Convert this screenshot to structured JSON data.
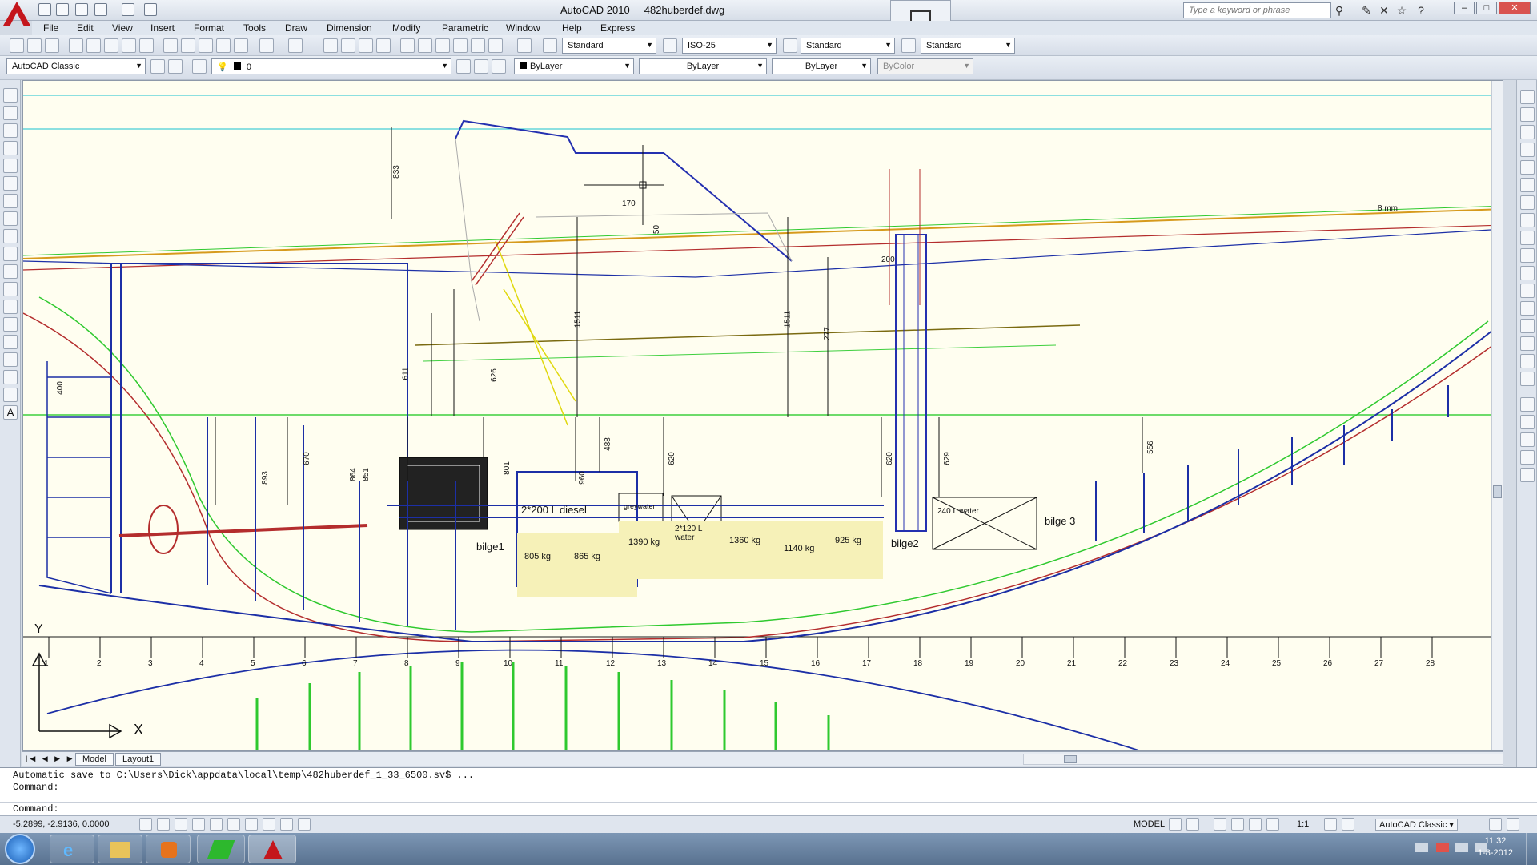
{
  "title_bar": {
    "app_name": "AutoCAD 2010",
    "file_name": "482huberdef.dwg",
    "search_placeholder": "Type a keyword or phrase"
  },
  "menu": [
    "File",
    "Edit",
    "View",
    "Insert",
    "Format",
    "Tools",
    "Draw",
    "Dimension",
    "Modify",
    "Parametric",
    "Window",
    "Help",
    "Express"
  ],
  "styles_toolbar": {
    "text_style": "Standard",
    "dim_style": "ISO-25",
    "table_style": "Standard",
    "mleader_style": "Standard"
  },
  "layers_toolbar": {
    "workspace": "AutoCAD Classic",
    "layer": "0",
    "color": "ByLayer",
    "linetype": "ByLayer",
    "lineweight": "ByLayer",
    "plot_style": "ByColor"
  },
  "drawing": {
    "dimensions": [
      "833",
      "170",
      "50",
      "1511",
      "1511",
      "277",
      "200",
      "611",
      "626",
      "400",
      "893",
      "670",
      "864",
      "851",
      "801",
      "960",
      "488",
      "620",
      "620",
      "629",
      "556",
      "8 mm"
    ],
    "labels": {
      "diesel": "2*200 L diesel",
      "greywater": "greywater",
      "water1": "2*120 L water",
      "water2": "240 L water",
      "bilge1": "bilge1",
      "bilge2": "bilge2",
      "bilge3": "bilge 3",
      "w805": "805 kg",
      "w865": "865 kg",
      "w1390": "1390 kg",
      "w1360": "1360 kg",
      "w1140": "1140 kg",
      "w925": "925 kg"
    },
    "frame_numbers": [
      "1",
      "2",
      "3",
      "4",
      "5",
      "6",
      "7",
      "8",
      "9",
      "10",
      "11",
      "12",
      "13",
      "14",
      "15",
      "16",
      "17",
      "18",
      "19",
      "20",
      "21",
      "22",
      "23",
      "24",
      "25",
      "26",
      "27",
      "28"
    ],
    "ucs": {
      "x": "X",
      "y": "Y"
    }
  },
  "tabs": [
    "Model",
    "Layout1"
  ],
  "command": {
    "history1": "Automatic save to C:\\Users\\Dick\\appdata\\local\\temp\\482huberdef_1_33_6500.sv$ ...",
    "history2": "Command:",
    "prompt": "Command:"
  },
  "status": {
    "coords": "-5.2899, -2.9136, 0.0000",
    "model": "MODEL",
    "scale": "1:1",
    "workspace": "AutoCAD Classic"
  },
  "taskbar": {
    "time": "11:32",
    "date": "1-8-2012"
  }
}
